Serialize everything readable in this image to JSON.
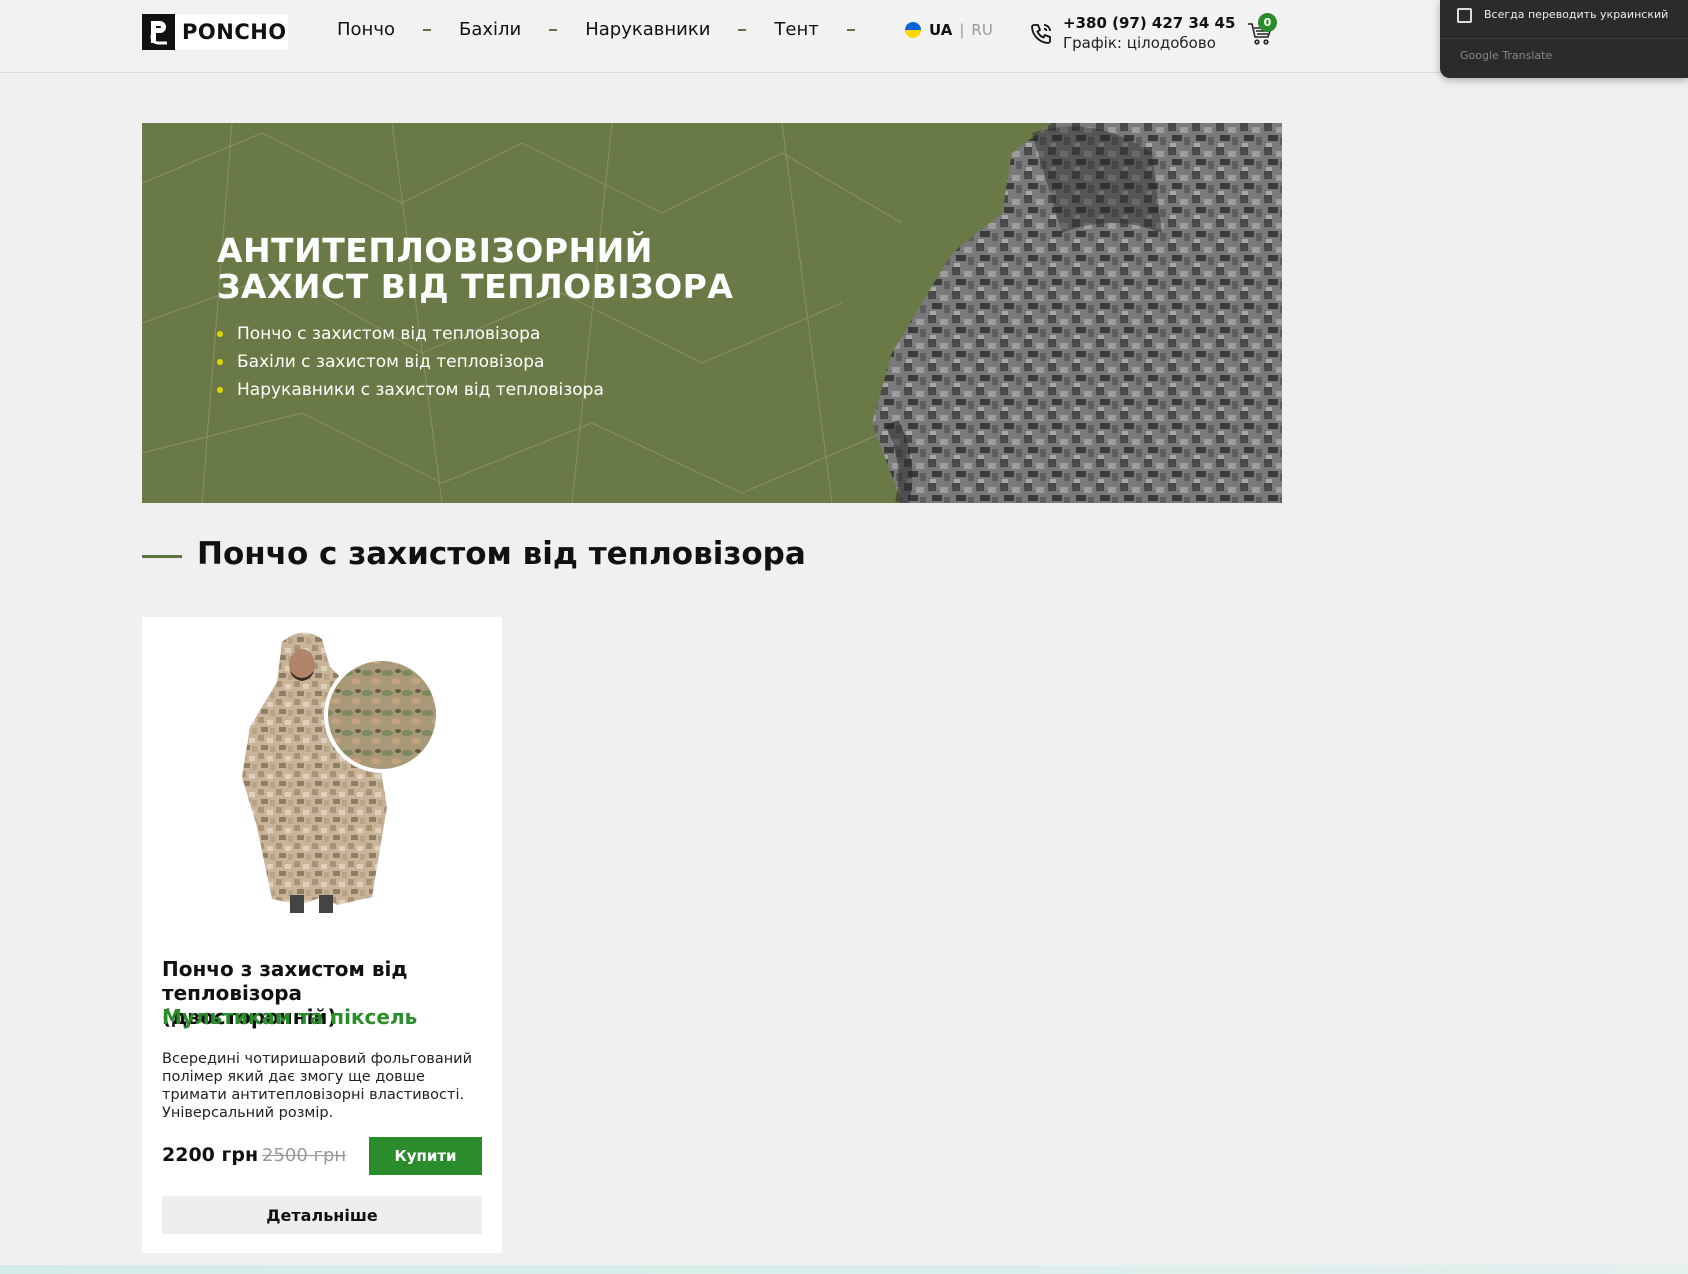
{
  "header": {
    "logo_text": "PONCHO",
    "nav": [
      "Пончо",
      "Бахіли",
      "Нарукавники",
      "Тент"
    ],
    "lang_active": "UA",
    "lang_sep": "|",
    "lang_other": "RU",
    "phone": "+380 (97) 427 34 45",
    "schedule": "Графік: цілодобово",
    "cart_count": "0"
  },
  "translate_popup": {
    "checkbox_label": "Всегда переводить украинский",
    "brand": "Google Translate"
  },
  "banner": {
    "title_line1": "АНТИТЕПЛОВІЗОРНИЙ",
    "title_line2": "ЗАХИСТ ВІД ТЕПЛОВІЗОРА",
    "items": [
      "Пончо с захистом від тепловізора",
      "Бахіли с захистом від тепловізора",
      "Нарукавники с захистом від тепловізора"
    ]
  },
  "section": {
    "title": "Пончо с захистом від тепловізора"
  },
  "product": {
    "title": "Пончо з захистом від тепловізора (двосторонній)",
    "subtitle": "Мультикам та піксель",
    "description": "Всередині чотиришаровий фольгований полімер який дає змогу ще довше тримати антитепловізорні властивості. Універсальний розмір.",
    "price": "2200 грн",
    "old_price": "2500 грн",
    "buy_label": "Купити",
    "more_label": "Детальніше"
  },
  "colors": {
    "accent_green": "#2a8c2a",
    "banner_olive": "#6a7a46"
  }
}
